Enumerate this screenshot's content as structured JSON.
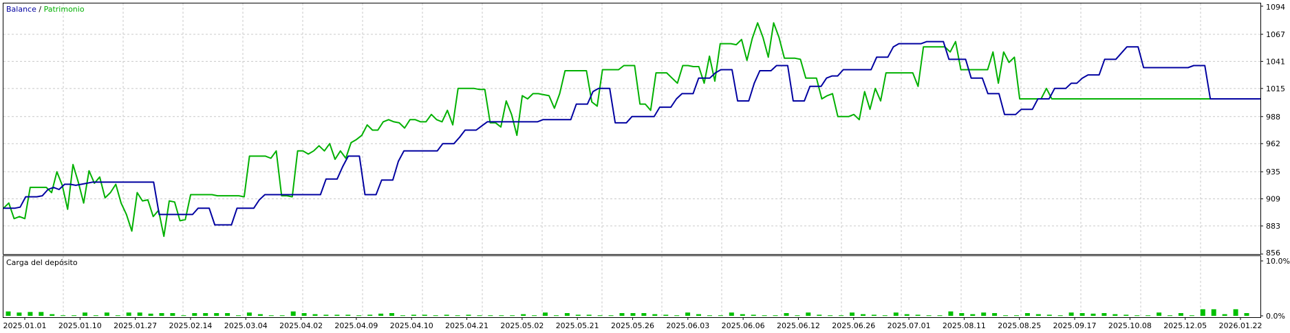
{
  "legend": {
    "balance_label": "Balance",
    "separator": " / ",
    "equity_label": "Patrimonio",
    "balance_color": "#0000a0",
    "equity_color": "#00b000"
  },
  "deposit_panel": {
    "title": "Carga del depósito",
    "bar_color": "#00c000"
  },
  "chart_data": [
    {
      "type": "line",
      "title": "",
      "xlabel": "",
      "ylabel": "",
      "ylim": [
        856,
        1094
      ],
      "y_ticks": [
        "1094",
        "1067",
        "1041",
        "1015",
        "988",
        "962",
        "935",
        "909",
        "883",
        "856"
      ],
      "x_ticks": [
        "2025.01.01",
        "2025.01.10",
        "2025.01.27",
        "2025.02.14",
        "2025.03.04",
        "2025.04.02",
        "2025.04.09",
        "2025.04.10",
        "2025.04.21",
        "2025.05.02",
        "2025.05.21",
        "2025.05.26",
        "2025.06.03",
        "2025.06.06",
        "2025.06.12",
        "2025.06.26",
        "2025.07.01",
        "2025.08.11",
        "2025.08.25",
        "2025.09.17",
        "2025.10.08",
        "2025.12.05",
        "2026.01.22"
      ],
      "grid": true,
      "legend_position": "top-left",
      "series": [
        {
          "name": "Balance",
          "values": [
            900,
            900,
            900,
            901,
            911,
            911,
            911,
            912,
            918,
            920,
            918,
            923,
            923,
            922,
            923,
            924,
            925,
            925,
            925,
            925,
            925,
            925,
            925,
            925,
            925,
            925,
            925,
            925,
            894,
            894,
            894,
            894,
            894,
            894,
            894,
            900,
            900,
            900,
            884,
            884,
            884,
            884,
            900,
            900,
            900,
            900,
            908,
            913,
            913,
            913,
            913,
            913,
            913,
            913,
            913,
            913,
            913,
            913,
            928,
            928,
            928,
            940,
            950,
            950,
            950,
            913,
            913,
            913,
            927,
            927,
            927,
            945,
            955,
            955,
            955,
            955,
            955,
            955,
            955,
            962,
            962,
            962,
            968,
            975,
            975,
            975,
            979,
            983,
            983,
            983,
            983,
            983,
            983,
            983,
            983,
            983,
            983,
            985,
            985,
            985,
            985,
            985,
            985,
            1000,
            1000,
            1000,
            1012,
            1015,
            1015,
            1015,
            982,
            982,
            982,
            988,
            988,
            988,
            988,
            988,
            997,
            997,
            997,
            1005,
            1010,
            1010,
            1010,
            1025,
            1025,
            1025,
            1030,
            1033,
            1033,
            1033,
            1003,
            1003,
            1003,
            1020,
            1032,
            1032,
            1032,
            1037,
            1037,
            1037,
            1003,
            1003,
            1003,
            1017,
            1017,
            1017,
            1025,
            1027,
            1027,
            1033,
            1033,
            1033,
            1033,
            1033,
            1033,
            1045,
            1045,
            1045,
            1055,
            1058,
            1058,
            1058,
            1058,
            1058,
            1060,
            1060,
            1060,
            1060,
            1043,
            1043,
            1043,
            1043,
            1025,
            1025,
            1025,
            1010,
            1010,
            1010,
            990,
            990,
            990,
            995,
            995,
            995,
            1005,
            1005,
            1005,
            1015,
            1015,
            1015,
            1020,
            1020,
            1025,
            1028,
            1028,
            1028,
            1043,
            1043,
            1043,
            1049,
            1055,
            1055,
            1055,
            1035,
            1035,
            1035,
            1035,
            1035,
            1035,
            1035,
            1035,
            1035,
            1037,
            1037,
            1037,
            1005,
            1005,
            1005,
            1005,
            1005,
            1005,
            1005,
            1005,
            1005,
            1005
          ]
        },
        {
          "name": "Patrimonio",
          "values": [
            900,
            905,
            890,
            892,
            890,
            920,
            920,
            920,
            920,
            915,
            935,
            922,
            899,
            942,
            925,
            905,
            936,
            924,
            930,
            910,
            915,
            923,
            905,
            894,
            878,
            915,
            907,
            908,
            892,
            898,
            873,
            907,
            906,
            888,
            889,
            913,
            913,
            913,
            913,
            913,
            912,
            912,
            912,
            912,
            912,
            911,
            950,
            950,
            950,
            950,
            948,
            955,
            912,
            912,
            911,
            955,
            955,
            952,
            955,
            960,
            955,
            962,
            947,
            955,
            948,
            963,
            966,
            970,
            980,
            975,
            975,
            983,
            985,
            983,
            982,
            977,
            985,
            985,
            983,
            983,
            990,
            985,
            983,
            994,
            980,
            1015,
            1015,
            1015,
            1015,
            1014,
            1014,
            982,
            982,
            978,
            1003,
            990,
            970,
            1008,
            1005,
            1010,
            1010,
            1009,
            1008,
            996,
            1010,
            1032,
            1032,
            1032,
            1032,
            1032,
            1002,
            998,
            1033,
            1033,
            1033,
            1033,
            1037,
            1037,
            1037,
            1000,
            1000,
            994,
            1030,
            1030,
            1030,
            1025,
            1020,
            1037,
            1037,
            1036,
            1036,
            1020,
            1046,
            1022,
            1058,
            1058,
            1058,
            1057,
            1062,
            1042,
            1063,
            1078,
            1064,
            1045,
            1078,
            1064,
            1044,
            1044,
            1044,
            1043,
            1025,
            1025,
            1025,
            1005,
            1008,
            1010,
            988,
            988,
            988,
            990,
            985,
            1012,
            995,
            1015,
            1003,
            1030,
            1030,
            1030,
            1030,
            1030,
            1030,
            1017,
            1055,
            1055,
            1055,
            1055,
            1055,
            1050,
            1060,
            1033,
            1033,
            1033,
            1033,
            1033,
            1033,
            1050,
            1020,
            1050,
            1040,
            1045,
            1005,
            1005,
            1005,
            1005,
            1005,
            1015,
            1005,
            1005,
            1005,
            1005,
            1005,
            1005,
            1005,
            1005,
            1005,
            1005,
            1005,
            1005,
            1005,
            1005,
            1005,
            1005,
            1005,
            1005,
            1005,
            1005,
            1005,
            1005,
            1005,
            1005,
            1005,
            1005,
            1005,
            1005,
            1005,
            1005,
            1005,
            1005,
            1005,
            1005,
            1005,
            1005,
            1005,
            1005,
            1005,
            1005
          ]
        }
      ]
    },
    {
      "type": "bar",
      "title": "Carga del depósito",
      "ylim": [
        0,
        10
      ],
      "y_ticks": [
        "10.0%",
        "0.0%"
      ],
      "grid": true,
      "values": [
        0.8,
        0.6,
        0.7,
        0.7,
        0.3,
        0.1,
        0.1,
        0.6,
        0.1,
        0.6,
        0.1,
        0.6,
        0.6,
        0.4,
        0.5,
        0.5,
        0.1,
        0.5,
        0.5,
        0.5,
        0.5,
        0.1,
        0.6,
        0.3,
        0.1,
        0.1,
        0.8,
        0.5,
        0.3,
        0.2,
        0.2,
        0.2,
        0.1,
        0.2,
        0.4,
        0.5,
        0.1,
        0.2,
        0.2,
        0.1,
        0.2,
        0.1,
        0.2,
        0.1,
        0.1,
        0.1,
        0.1,
        0.3,
        0.1,
        0.6,
        0.1,
        0.5,
        0.2,
        0.2,
        0.1,
        0.1,
        0.5,
        0.5,
        0.5,
        0.3,
        0.2,
        0.1,
        0.6,
        0.3,
        0.1,
        0.1,
        0.6,
        0.3,
        0.2,
        0.1,
        0.1,
        0.5,
        0.1,
        0.6,
        0.2,
        0.1,
        0.1,
        0.6,
        0.3,
        0.2,
        0.1,
        0.6,
        0.3,
        0.2,
        0.1,
        0.1,
        0.8,
        0.5,
        0.3,
        0.6,
        0.5,
        0.1,
        0.1,
        0.5,
        0.3,
        0.2,
        0.1,
        0.6,
        0.5,
        0.4,
        0.5,
        0.3,
        0.2,
        0.1,
        0.1,
        0.6,
        0.1,
        0.5,
        0.1,
        1.2,
        1.2,
        0.3,
        1.2,
        0.5
      ]
    }
  ]
}
